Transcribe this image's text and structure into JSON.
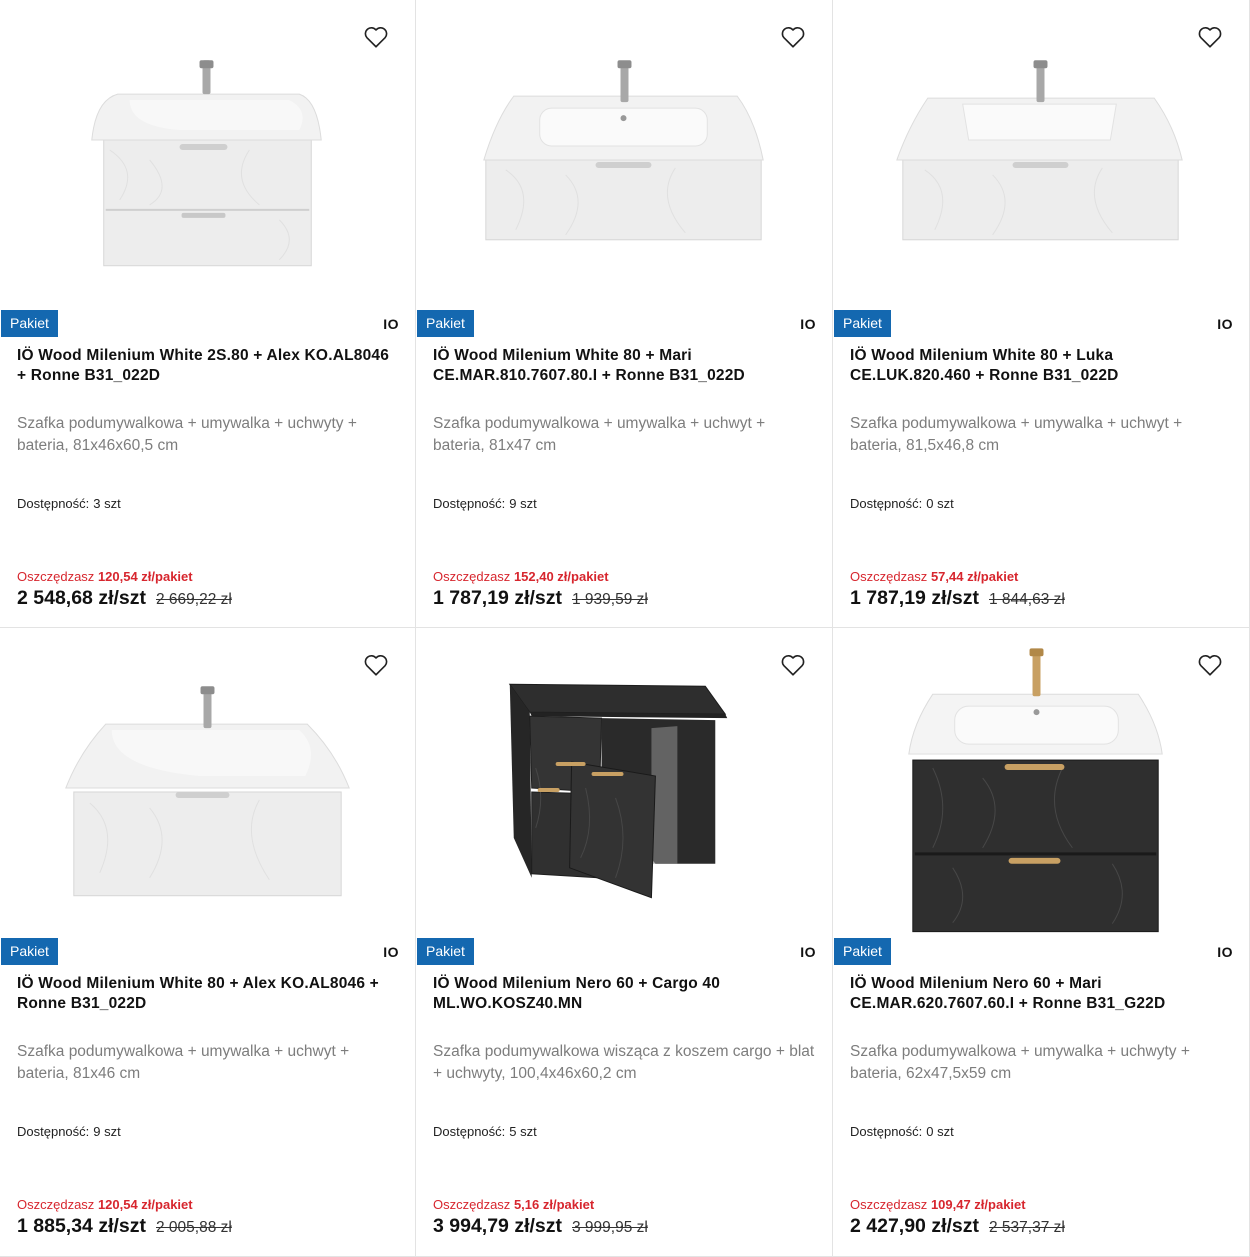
{
  "colors": {
    "badge": "#1468b0",
    "save": "#d7262e"
  },
  "products": [
    {
      "image": "white-vanity-2-drawers",
      "badge": "Pakiet",
      "brand": "IO",
      "title": "IÖ Wood Milenium White 2S.80 + Alex KO.AL8046 + Ronne B31_022D",
      "desc": "Szafka podumywalkowa + umywalka + uchwyty + bateria, 81x46x60,5 cm",
      "avail_label": "Dostępność:",
      "avail_qty": "3 szt",
      "save_label": "Oszczędzasz",
      "save_value": "120,54 zł/pakiet",
      "price": "2 548,68 zł/szt",
      "old_price": "2 669,22 zł"
    },
    {
      "image": "white-vanity-1-drawer-mari",
      "badge": "Pakiet",
      "brand": "IO",
      "title": "IÖ Wood Milenium White 80 + Mari CE.MAR.810.7607.80.I + Ronne B31_022D",
      "desc": "Szafka podumywalkowa + umywalka + uchwyt + bateria, 81x47 cm",
      "avail_label": "Dostępność:",
      "avail_qty": "9 szt",
      "save_label": "Oszczędzasz",
      "save_value": "152,40 zł/pakiet",
      "price": "1 787,19 zł/szt",
      "old_price": "1 939,59 zł"
    },
    {
      "image": "white-vanity-1-drawer-luka",
      "badge": "Pakiet",
      "brand": "IO",
      "title": "IÖ Wood Milenium White 80 + Luka CE.LUK.820.460 + Ronne B31_022D",
      "desc": "Szafka podumywalkowa + umywalka + uchwyt + bateria, 81,5x46,8 cm",
      "avail_label": "Dostępność:",
      "avail_qty": "0 szt",
      "save_label": "Oszczędzasz",
      "save_value": "57,44 zł/pakiet",
      "price": "1 787,19 zł/szt",
      "old_price": "1 844,63 zł"
    },
    {
      "image": "white-vanity-1-drawer-alex",
      "badge": "Pakiet",
      "brand": "IO",
      "title": "IÖ Wood Milenium White 80 + Alex KO.AL8046 + Ronne B31_022D",
      "desc": "Szafka podumywalkowa + umywalka + uchwyt + bateria, 81x46 cm",
      "avail_label": "Dostępność:",
      "avail_qty": "9 szt",
      "save_label": "Oszczędzasz",
      "save_value": "120,54 zł/pakiet",
      "price": "1 885,34 zł/szt",
      "old_price": "2 005,88 zł"
    },
    {
      "image": "black-cabinet-cargo",
      "badge": "Pakiet",
      "brand": "IO",
      "title": "IÖ Wood Milenium Nero 60 + Cargo 40 ML.WO.KOSZ40.MN",
      "desc": "Szafka podumywalkowa wisząca z koszem cargo + blat + uchwyty, 100,4x46x60,2 cm",
      "avail_label": "Dostępność:",
      "avail_qty": "5 szt",
      "save_label": "Oszczędzasz",
      "save_value": "5,16 zł/pakiet",
      "price": "3 994,79 zł/szt",
      "old_price": "3 999,95 zł"
    },
    {
      "image": "black-vanity-gold-faucet",
      "badge": "Pakiet",
      "brand": "IO",
      "title": "IÖ Wood Milenium Nero 60 + Mari CE.MAR.620.7607.60.I + Ronne B31_G22D",
      "desc": "Szafka podumywalkowa + umywalka + uchwyty + bateria, 62x47,5x59 cm",
      "avail_label": "Dostępność:",
      "avail_qty": "0 szt",
      "save_label": "Oszczędzasz",
      "save_value": "109,47 zł/pakiet",
      "price": "2 427,90 zł/szt",
      "old_price": "2 537,37 zł"
    }
  ]
}
